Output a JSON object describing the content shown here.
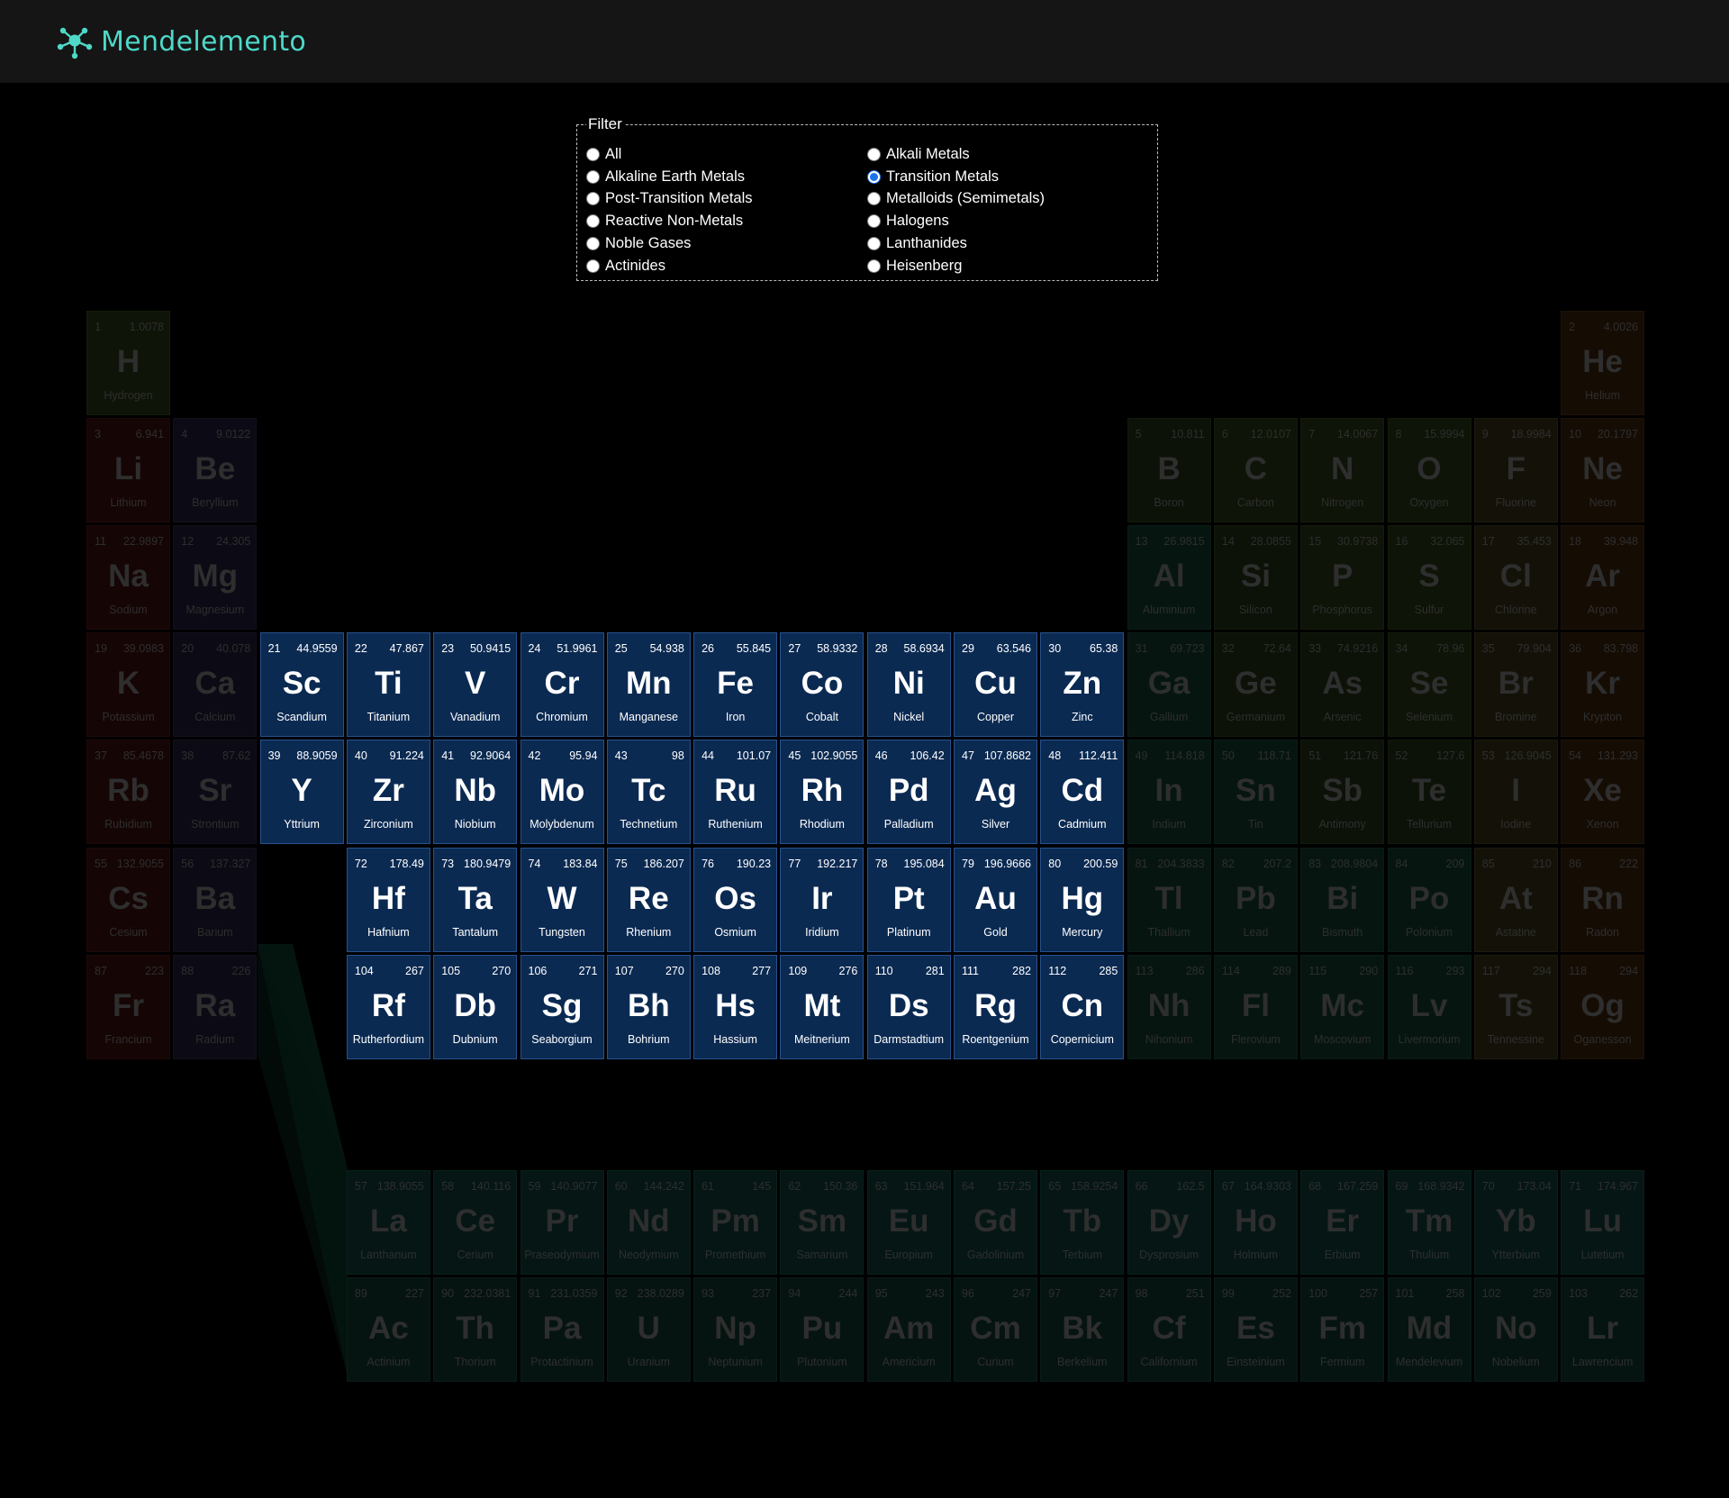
{
  "app": {
    "brand": "Mendelemento",
    "logo_icon": "molecule-icon",
    "accent": "#4fd8c8"
  },
  "filter": {
    "legend": "Filter",
    "selected": "Transition Metals",
    "options": [
      "All",
      "Alkali Metals",
      "Alkaline Earth Metals",
      "Transition Metals",
      "Post-Transition Metals",
      "Metalloids (Semimetals)",
      "Reactive Non-Metals",
      "Halogens",
      "Noble Gases",
      "Lanthanides",
      "Actinides",
      "Heisenberg"
    ]
  },
  "category_colors": {
    "reactive-nonmetal": "#0e1407",
    "alkali": "#160505",
    "alkaline-earth": "#0c0a14",
    "transition": "#0b2a52",
    "post-transition": "#061510",
    "metalloid": "#0c1208",
    "halogen": "#141208",
    "noble": "#150c04",
    "lanthanide": "#051615",
    "actinide": "#061411"
  },
  "elements": [
    {
      "n": 1,
      "s": "H",
      "name": "Hydrogen",
      "m": "1.0078",
      "r": 1,
      "c": 1,
      "cat": "reactive-nonmetal"
    },
    {
      "n": 2,
      "s": "He",
      "name": "Helium",
      "m": "4.0026",
      "r": 1,
      "c": 18,
      "cat": "noble"
    },
    {
      "n": 3,
      "s": "Li",
      "name": "Lithium",
      "m": "6.941",
      "r": 2,
      "c": 1,
      "cat": "alkali"
    },
    {
      "n": 4,
      "s": "Be",
      "name": "Beryllium",
      "m": "9.0122",
      "r": 2,
      "c": 2,
      "cat": "alkaline-earth"
    },
    {
      "n": 5,
      "s": "B",
      "name": "Boron",
      "m": "10.811",
      "r": 2,
      "c": 13,
      "cat": "metalloid"
    },
    {
      "n": 6,
      "s": "C",
      "name": "Carbon",
      "m": "12.0107",
      "r": 2,
      "c": 14,
      "cat": "reactive-nonmetal"
    },
    {
      "n": 7,
      "s": "N",
      "name": "Nitrogen",
      "m": "14.0067",
      "r": 2,
      "c": 15,
      "cat": "reactive-nonmetal"
    },
    {
      "n": 8,
      "s": "O",
      "name": "Oxygen",
      "m": "15.9994",
      "r": 2,
      "c": 16,
      "cat": "reactive-nonmetal"
    },
    {
      "n": 9,
      "s": "F",
      "name": "Fluorine",
      "m": "18.9984",
      "r": 2,
      "c": 17,
      "cat": "halogen"
    },
    {
      "n": 10,
      "s": "Ne",
      "name": "Neon",
      "m": "20.1797",
      "r": 2,
      "c": 18,
      "cat": "noble"
    },
    {
      "n": 11,
      "s": "Na",
      "name": "Sodium",
      "m": "22.9897",
      "r": 3,
      "c": 1,
      "cat": "alkali"
    },
    {
      "n": 12,
      "s": "Mg",
      "name": "Magnesium",
      "m": "24.305",
      "r": 3,
      "c": 2,
      "cat": "alkaline-earth"
    },
    {
      "n": 13,
      "s": "Al",
      "name": "Aluminium",
      "m": "26.9815",
      "r": 3,
      "c": 13,
      "cat": "post-transition"
    },
    {
      "n": 14,
      "s": "Si",
      "name": "Silicon",
      "m": "28.0855",
      "r": 3,
      "c": 14,
      "cat": "metalloid"
    },
    {
      "n": 15,
      "s": "P",
      "name": "Phosphorus",
      "m": "30.9738",
      "r": 3,
      "c": 15,
      "cat": "reactive-nonmetal"
    },
    {
      "n": 16,
      "s": "S",
      "name": "Sulfur",
      "m": "32.065",
      "r": 3,
      "c": 16,
      "cat": "reactive-nonmetal"
    },
    {
      "n": 17,
      "s": "Cl",
      "name": "Chlorine",
      "m": "35.453",
      "r": 3,
      "c": 17,
      "cat": "halogen"
    },
    {
      "n": 18,
      "s": "Ar",
      "name": "Argon",
      "m": "39.948",
      "r": 3,
      "c": 18,
      "cat": "noble"
    },
    {
      "n": 19,
      "s": "K",
      "name": "Potassium",
      "m": "39.0983",
      "r": 4,
      "c": 1,
      "cat": "alkali"
    },
    {
      "n": 20,
      "s": "Ca",
      "name": "Calcium",
      "m": "40.078",
      "r": 4,
      "c": 2,
      "cat": "alkaline-earth"
    },
    {
      "n": 21,
      "s": "Sc",
      "name": "Scandium",
      "m": "44.9559",
      "r": 4,
      "c": 3,
      "cat": "transition"
    },
    {
      "n": 22,
      "s": "Ti",
      "name": "Titanium",
      "m": "47.867",
      "r": 4,
      "c": 4,
      "cat": "transition"
    },
    {
      "n": 23,
      "s": "V",
      "name": "Vanadium",
      "m": "50.9415",
      "r": 4,
      "c": 5,
      "cat": "transition"
    },
    {
      "n": 24,
      "s": "Cr",
      "name": "Chromium",
      "m": "51.9961",
      "r": 4,
      "c": 6,
      "cat": "transition"
    },
    {
      "n": 25,
      "s": "Mn",
      "name": "Manganese",
      "m": "54.938",
      "r": 4,
      "c": 7,
      "cat": "transition"
    },
    {
      "n": 26,
      "s": "Fe",
      "name": "Iron",
      "m": "55.845",
      "r": 4,
      "c": 8,
      "cat": "transition"
    },
    {
      "n": 27,
      "s": "Co",
      "name": "Cobalt",
      "m": "58.9332",
      "r": 4,
      "c": 9,
      "cat": "transition"
    },
    {
      "n": 28,
      "s": "Ni",
      "name": "Nickel",
      "m": "58.6934",
      "r": 4,
      "c": 10,
      "cat": "transition"
    },
    {
      "n": 29,
      "s": "Cu",
      "name": "Copper",
      "m": "63.546",
      "r": 4,
      "c": 11,
      "cat": "transition"
    },
    {
      "n": 30,
      "s": "Zn",
      "name": "Zinc",
      "m": "65.38",
      "r": 4,
      "c": 12,
      "cat": "transition"
    },
    {
      "n": 31,
      "s": "Ga",
      "name": "Gallium",
      "m": "69.723",
      "r": 4,
      "c": 13,
      "cat": "post-transition"
    },
    {
      "n": 32,
      "s": "Ge",
      "name": "Germanium",
      "m": "72.64",
      "r": 4,
      "c": 14,
      "cat": "metalloid"
    },
    {
      "n": 33,
      "s": "As",
      "name": "Arsenic",
      "m": "74.9216",
      "r": 4,
      "c": 15,
      "cat": "metalloid"
    },
    {
      "n": 34,
      "s": "Se",
      "name": "Selenium",
      "m": "78.96",
      "r": 4,
      "c": 16,
      "cat": "reactive-nonmetal"
    },
    {
      "n": 35,
      "s": "Br",
      "name": "Bromine",
      "m": "79.904",
      "r": 4,
      "c": 17,
      "cat": "halogen"
    },
    {
      "n": 36,
      "s": "Kr",
      "name": "Krypton",
      "m": "83.798",
      "r": 4,
      "c": 18,
      "cat": "noble"
    },
    {
      "n": 37,
      "s": "Rb",
      "name": "Rubidium",
      "m": "85.4678",
      "r": 5,
      "c": 1,
      "cat": "alkali"
    },
    {
      "n": 38,
      "s": "Sr",
      "name": "Strontium",
      "m": "87.62",
      "r": 5,
      "c": 2,
      "cat": "alkaline-earth"
    },
    {
      "n": 39,
      "s": "Y",
      "name": "Yttrium",
      "m": "88.9059",
      "r": 5,
      "c": 3,
      "cat": "transition"
    },
    {
      "n": 40,
      "s": "Zr",
      "name": "Zirconium",
      "m": "91.224",
      "r": 5,
      "c": 4,
      "cat": "transition"
    },
    {
      "n": 41,
      "s": "Nb",
      "name": "Niobium",
      "m": "92.9064",
      "r": 5,
      "c": 5,
      "cat": "transition"
    },
    {
      "n": 42,
      "s": "Mo",
      "name": "Molybdenum",
      "m": "95.94",
      "r": 5,
      "c": 6,
      "cat": "transition"
    },
    {
      "n": 43,
      "s": "Tc",
      "name": "Technetium",
      "m": "98",
      "r": 5,
      "c": 7,
      "cat": "transition"
    },
    {
      "n": 44,
      "s": "Ru",
      "name": "Ruthenium",
      "m": "101.07",
      "r": 5,
      "c": 8,
      "cat": "transition"
    },
    {
      "n": 45,
      "s": "Rh",
      "name": "Rhodium",
      "m": "102.9055",
      "r": 5,
      "c": 9,
      "cat": "transition"
    },
    {
      "n": 46,
      "s": "Pd",
      "name": "Palladium",
      "m": "106.42",
      "r": 5,
      "c": 10,
      "cat": "transition"
    },
    {
      "n": 47,
      "s": "Ag",
      "name": "Silver",
      "m": "107.8682",
      "r": 5,
      "c": 11,
      "cat": "transition"
    },
    {
      "n": 48,
      "s": "Cd",
      "name": "Cadmium",
      "m": "112.411",
      "r": 5,
      "c": 12,
      "cat": "transition"
    },
    {
      "n": 49,
      "s": "In",
      "name": "Indium",
      "m": "114.818",
      "r": 5,
      "c": 13,
      "cat": "post-transition"
    },
    {
      "n": 50,
      "s": "Sn",
      "name": "Tin",
      "m": "118.71",
      "r": 5,
      "c": 14,
      "cat": "post-transition"
    },
    {
      "n": 51,
      "s": "Sb",
      "name": "Antimony",
      "m": "121.76",
      "r": 5,
      "c": 15,
      "cat": "metalloid"
    },
    {
      "n": 52,
      "s": "Te",
      "name": "Tellurium",
      "m": "127.6",
      "r": 5,
      "c": 16,
      "cat": "metalloid"
    },
    {
      "n": 53,
      "s": "I",
      "name": "Iodine",
      "m": "126.9045",
      "r": 5,
      "c": 17,
      "cat": "halogen"
    },
    {
      "n": 54,
      "s": "Xe",
      "name": "Xenon",
      "m": "131.293",
      "r": 5,
      "c": 18,
      "cat": "noble"
    },
    {
      "n": 55,
      "s": "Cs",
      "name": "Cesium",
      "m": "132.9055",
      "r": 6,
      "c": 1,
      "cat": "alkali"
    },
    {
      "n": 56,
      "s": "Ba",
      "name": "Barium",
      "m": "137.327",
      "r": 6,
      "c": 2,
      "cat": "alkaline-earth"
    },
    {
      "n": 72,
      "s": "Hf",
      "name": "Hafnium",
      "m": "178.49",
      "r": 6,
      "c": 4,
      "cat": "transition"
    },
    {
      "n": 73,
      "s": "Ta",
      "name": "Tantalum",
      "m": "180.9479",
      "r": 6,
      "c": 5,
      "cat": "transition"
    },
    {
      "n": 74,
      "s": "W",
      "name": "Tungsten",
      "m": "183.84",
      "r": 6,
      "c": 6,
      "cat": "transition"
    },
    {
      "n": 75,
      "s": "Re",
      "name": "Rhenium",
      "m": "186.207",
      "r": 6,
      "c": 7,
      "cat": "transition"
    },
    {
      "n": 76,
      "s": "Os",
      "name": "Osmium",
      "m": "190.23",
      "r": 6,
      "c": 8,
      "cat": "transition"
    },
    {
      "n": 77,
      "s": "Ir",
      "name": "Iridium",
      "m": "192.217",
      "r": 6,
      "c": 9,
      "cat": "transition"
    },
    {
      "n": 78,
      "s": "Pt",
      "name": "Platinum",
      "m": "195.084",
      "r": 6,
      "c": 10,
      "cat": "transition"
    },
    {
      "n": 79,
      "s": "Au",
      "name": "Gold",
      "m": "196.9666",
      "r": 6,
      "c": 11,
      "cat": "transition"
    },
    {
      "n": 80,
      "s": "Hg",
      "name": "Mercury",
      "m": "200.59",
      "r": 6,
      "c": 12,
      "cat": "transition"
    },
    {
      "n": 81,
      "s": "Tl",
      "name": "Thallium",
      "m": "204.3833",
      "r": 6,
      "c": 13,
      "cat": "post-transition"
    },
    {
      "n": 82,
      "s": "Pb",
      "name": "Lead",
      "m": "207.2",
      "r": 6,
      "c": 14,
      "cat": "post-transition"
    },
    {
      "n": 83,
      "s": "Bi",
      "name": "Bismuth",
      "m": "208.9804",
      "r": 6,
      "c": 15,
      "cat": "post-transition"
    },
    {
      "n": 84,
      "s": "Po",
      "name": "Polonium",
      "m": "209",
      "r": 6,
      "c": 16,
      "cat": "post-transition"
    },
    {
      "n": 85,
      "s": "At",
      "name": "Astatine",
      "m": "210",
      "r": 6,
      "c": 17,
      "cat": "halogen"
    },
    {
      "n": 86,
      "s": "Rn",
      "name": "Radon",
      "m": "222",
      "r": 6,
      "c": 18,
      "cat": "noble"
    },
    {
      "n": 87,
      "s": "Fr",
      "name": "Francium",
      "m": "223",
      "r": 7,
      "c": 1,
      "cat": "alkali"
    },
    {
      "n": 88,
      "s": "Ra",
      "name": "Radium",
      "m": "226",
      "r": 7,
      "c": 2,
      "cat": "alkaline-earth"
    },
    {
      "n": 104,
      "s": "Rf",
      "name": "Rutherfordium",
      "m": "267",
      "r": 7,
      "c": 4,
      "cat": "transition"
    },
    {
      "n": 105,
      "s": "Db",
      "name": "Dubnium",
      "m": "270",
      "r": 7,
      "c": 5,
      "cat": "transition"
    },
    {
      "n": 106,
      "s": "Sg",
      "name": "Seaborgium",
      "m": "271",
      "r": 7,
      "c": 6,
      "cat": "transition"
    },
    {
      "n": 107,
      "s": "Bh",
      "name": "Bohrium",
      "m": "270",
      "r": 7,
      "c": 7,
      "cat": "transition"
    },
    {
      "n": 108,
      "s": "Hs",
      "name": "Hassium",
      "m": "277",
      "r": 7,
      "c": 8,
      "cat": "transition"
    },
    {
      "n": 109,
      "s": "Mt",
      "name": "Meitnerium",
      "m": "276",
      "r": 7,
      "c": 9,
      "cat": "transition"
    },
    {
      "n": 110,
      "s": "Ds",
      "name": "Darmstadtium",
      "m": "281",
      "r": 7,
      "c": 10,
      "cat": "transition"
    },
    {
      "n": 111,
      "s": "Rg",
      "name": "Roentgenium",
      "m": "282",
      "r": 7,
      "c": 11,
      "cat": "transition"
    },
    {
      "n": 112,
      "s": "Cn",
      "name": "Copernicium",
      "m": "285",
      "r": 7,
      "c": 12,
      "cat": "transition"
    },
    {
      "n": 113,
      "s": "Nh",
      "name": "Nihonium",
      "m": "286",
      "r": 7,
      "c": 13,
      "cat": "post-transition"
    },
    {
      "n": 114,
      "s": "Fl",
      "name": "Flerovium",
      "m": "289",
      "r": 7,
      "c": 14,
      "cat": "post-transition"
    },
    {
      "n": 115,
      "s": "Mc",
      "name": "Moscovium",
      "m": "290",
      "r": 7,
      "c": 15,
      "cat": "post-transition"
    },
    {
      "n": 116,
      "s": "Lv",
      "name": "Livermorium",
      "m": "293",
      "r": 7,
      "c": 16,
      "cat": "post-transition"
    },
    {
      "n": 117,
      "s": "Ts",
      "name": "Tennessine",
      "m": "294",
      "r": 7,
      "c": 17,
      "cat": "halogen"
    },
    {
      "n": 118,
      "s": "Og",
      "name": "Oganesson",
      "m": "294",
      "r": 7,
      "c": 18,
      "cat": "noble"
    },
    {
      "n": 57,
      "s": "La",
      "name": "Lanthanum",
      "m": "138.9055",
      "r": 9,
      "c": 4,
      "cat": "lanthanide"
    },
    {
      "n": 58,
      "s": "Ce",
      "name": "Cerium",
      "m": "140.116",
      "r": 9,
      "c": 5,
      "cat": "lanthanide"
    },
    {
      "n": 59,
      "s": "Pr",
      "name": "Praseodymium",
      "m": "140.9077",
      "r": 9,
      "c": 6,
      "cat": "lanthanide"
    },
    {
      "n": 60,
      "s": "Nd",
      "name": "Neodymium",
      "m": "144.242",
      "r": 9,
      "c": 7,
      "cat": "lanthanide"
    },
    {
      "n": 61,
      "s": "Pm",
      "name": "Promethium",
      "m": "145",
      "r": 9,
      "c": 8,
      "cat": "lanthanide"
    },
    {
      "n": 62,
      "s": "Sm",
      "name": "Samarium",
      "m": "150.36",
      "r": 9,
      "c": 9,
      "cat": "lanthanide"
    },
    {
      "n": 63,
      "s": "Eu",
      "name": "Europium",
      "m": "151.964",
      "r": 9,
      "c": 10,
      "cat": "lanthanide"
    },
    {
      "n": 64,
      "s": "Gd",
      "name": "Gadolinium",
      "m": "157.25",
      "r": 9,
      "c": 11,
      "cat": "lanthanide"
    },
    {
      "n": 65,
      "s": "Tb",
      "name": "Terbium",
      "m": "158.9254",
      "r": 9,
      "c": 12,
      "cat": "lanthanide"
    },
    {
      "n": 66,
      "s": "Dy",
      "name": "Dysprosium",
      "m": "162.5",
      "r": 9,
      "c": 13,
      "cat": "lanthanide"
    },
    {
      "n": 67,
      "s": "Ho",
      "name": "Holmium",
      "m": "164.9303",
      "r": 9,
      "c": 14,
      "cat": "lanthanide"
    },
    {
      "n": 68,
      "s": "Er",
      "name": "Erbium",
      "m": "167.259",
      "r": 9,
      "c": 15,
      "cat": "lanthanide"
    },
    {
      "n": 69,
      "s": "Tm",
      "name": "Thulium",
      "m": "168.9342",
      "r": 9,
      "c": 16,
      "cat": "lanthanide"
    },
    {
      "n": 70,
      "s": "Yb",
      "name": "Ytterbium",
      "m": "173.04",
      "r": 9,
      "c": 17,
      "cat": "lanthanide"
    },
    {
      "n": 71,
      "s": "Lu",
      "name": "Lutetium",
      "m": "174.967",
      "r": 9,
      "c": 18,
      "cat": "lanthanide"
    },
    {
      "n": 89,
      "s": "Ac",
      "name": "Actinium",
      "m": "227",
      "r": 10,
      "c": 4,
      "cat": "actinide"
    },
    {
      "n": 90,
      "s": "Th",
      "name": "Thorium",
      "m": "232.0381",
      "r": 10,
      "c": 5,
      "cat": "actinide"
    },
    {
      "n": 91,
      "s": "Pa",
      "name": "Protactinium",
      "m": "231.0359",
      "r": 10,
      "c": 6,
      "cat": "actinide"
    },
    {
      "n": 92,
      "s": "U",
      "name": "Uranium",
      "m": "238.0289",
      "r": 10,
      "c": 7,
      "cat": "actinide"
    },
    {
      "n": 93,
      "s": "Np",
      "name": "Neptunium",
      "m": "237",
      "r": 10,
      "c": 8,
      "cat": "actinide"
    },
    {
      "n": 94,
      "s": "Pu",
      "name": "Plutonium",
      "m": "244",
      "r": 10,
      "c": 9,
      "cat": "actinide"
    },
    {
      "n": 95,
      "s": "Am",
      "name": "Americium",
      "m": "243",
      "r": 10,
      "c": 10,
      "cat": "actinide"
    },
    {
      "n": 96,
      "s": "Cm",
      "name": "Curium",
      "m": "247",
      "r": 10,
      "c": 11,
      "cat": "actinide"
    },
    {
      "n": 97,
      "s": "Bk",
      "name": "Berkelium",
      "m": "247",
      "r": 10,
      "c": 12,
      "cat": "actinide"
    },
    {
      "n": 98,
      "s": "Cf",
      "name": "Californium",
      "m": "251",
      "r": 10,
      "c": 13,
      "cat": "actinide"
    },
    {
      "n": 99,
      "s": "Es",
      "name": "Einsteinium",
      "m": "252",
      "r": 10,
      "c": 14,
      "cat": "actinide"
    },
    {
      "n": 100,
      "s": "Fm",
      "name": "Fermium",
      "m": "257",
      "r": 10,
      "c": 15,
      "cat": "actinide"
    },
    {
      "n": 101,
      "s": "Md",
      "name": "Mendelevium",
      "m": "258",
      "r": 10,
      "c": 16,
      "cat": "actinide"
    },
    {
      "n": 102,
      "s": "No",
      "name": "Nobelium",
      "m": "259",
      "r": 10,
      "c": 17,
      "cat": "actinide"
    },
    {
      "n": 103,
      "s": "Lr",
      "name": "Lawrencium",
      "m": "262",
      "r": 10,
      "c": 18,
      "cat": "actinide"
    }
  ]
}
